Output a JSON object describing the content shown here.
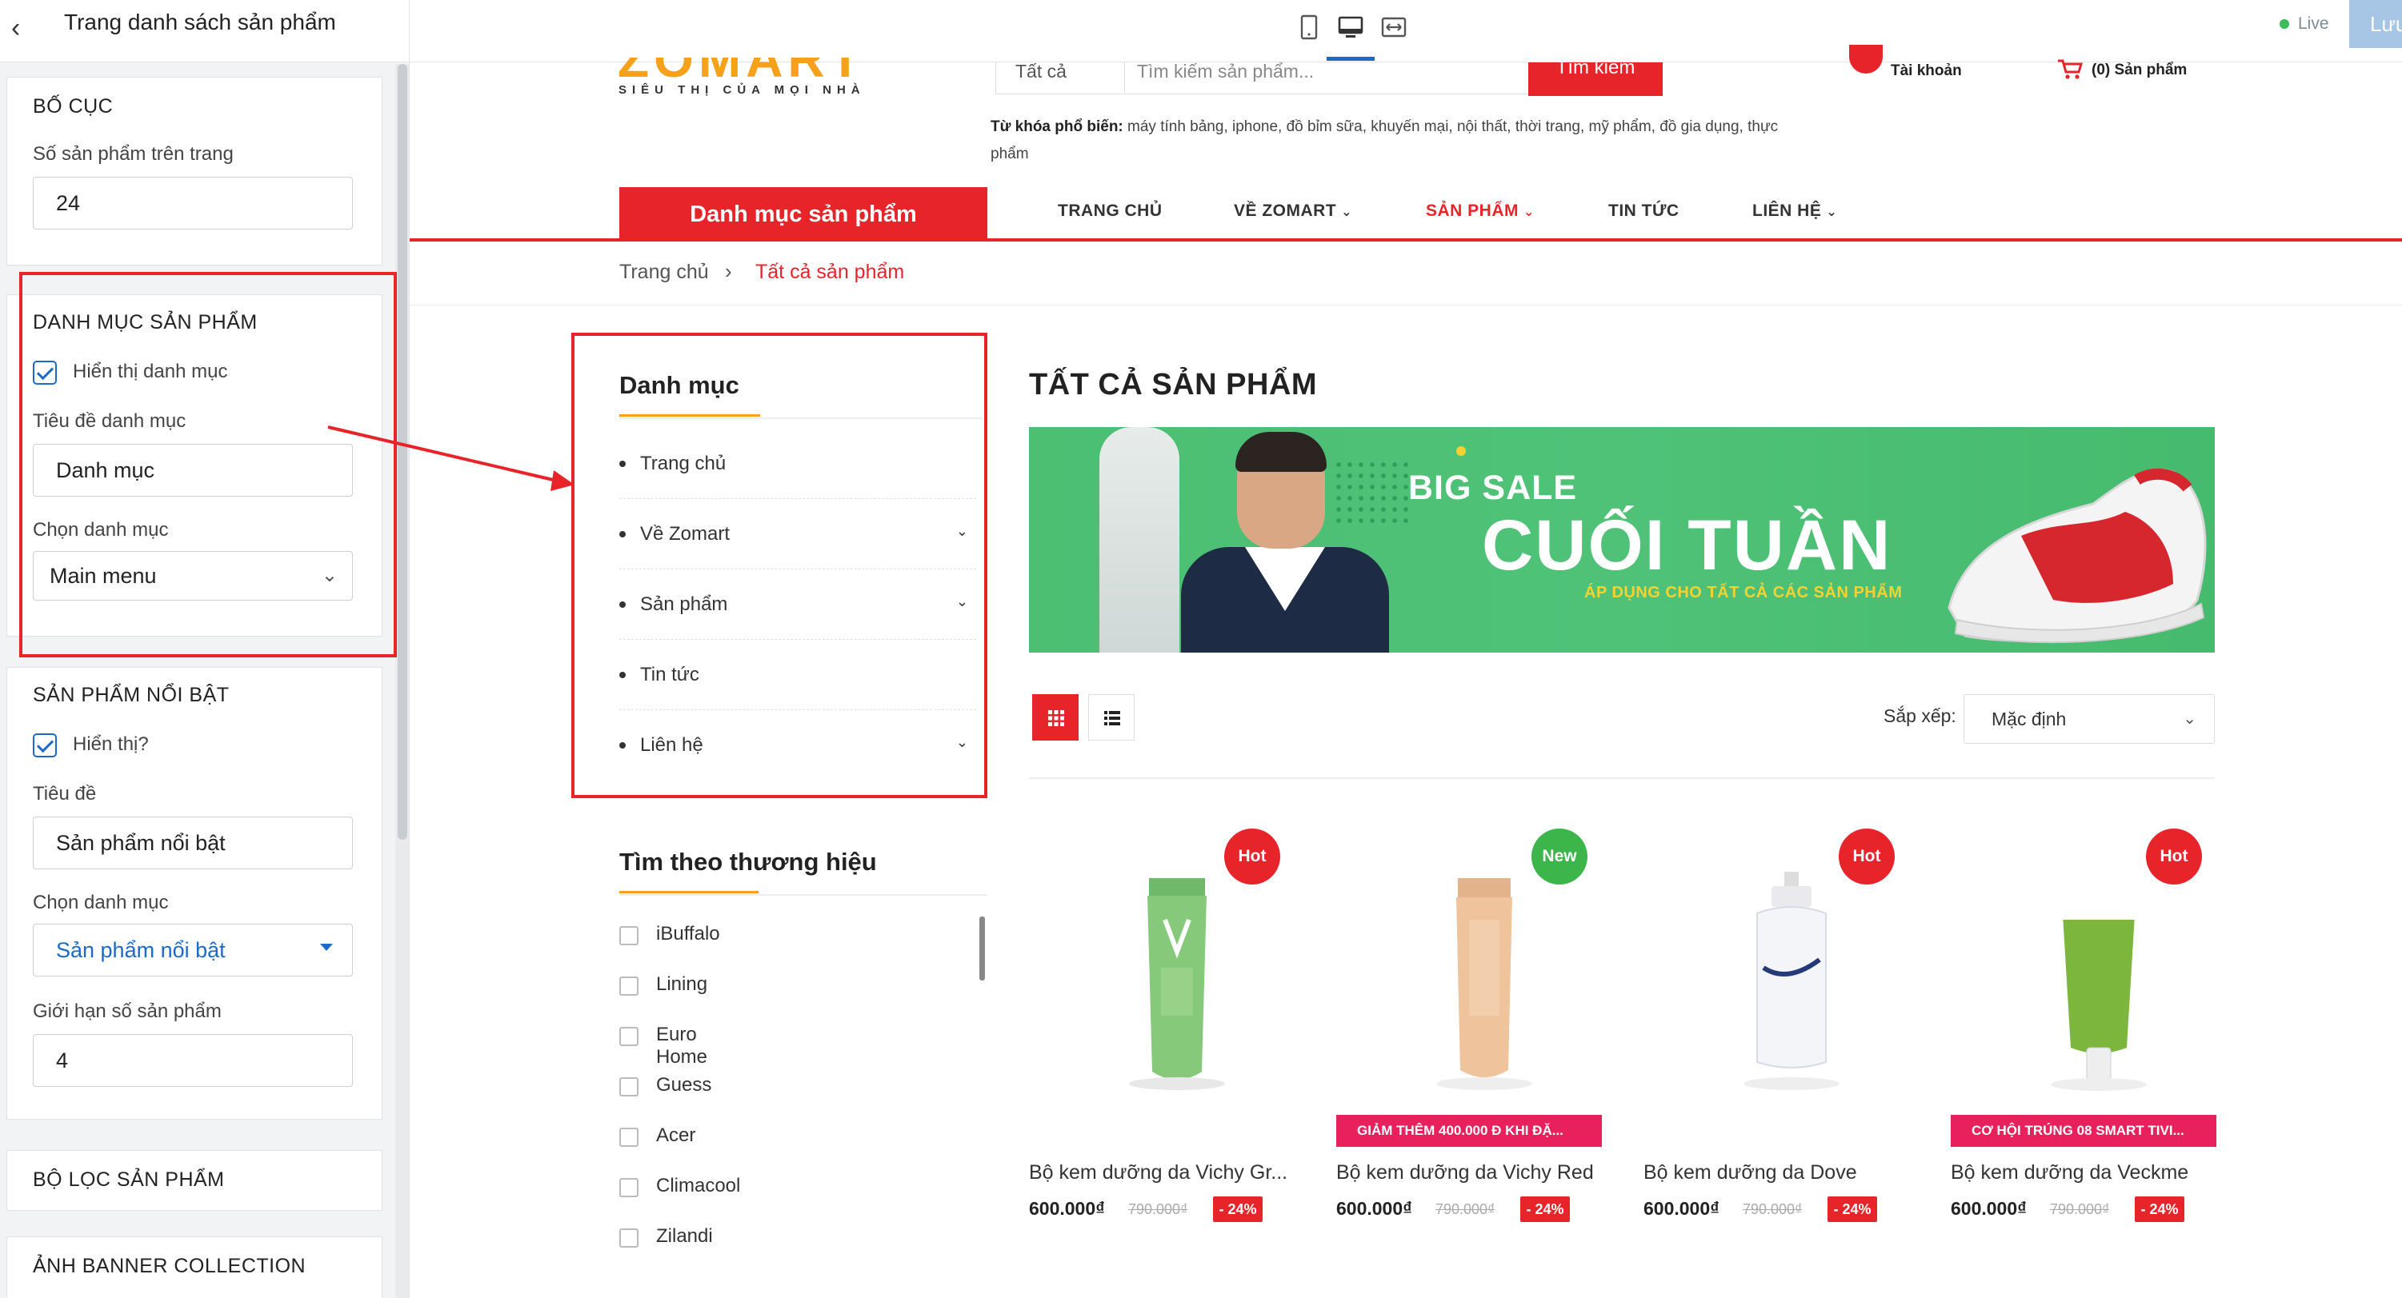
{
  "editor": {
    "title": "Trang danh sách sản phẩm",
    "layout": {
      "title": "BỐ CỤC",
      "per_page_label": "Số sản phẩm trên trang",
      "per_page_value": "24"
    },
    "category": {
      "title": "DANH MỤC SẢN PHẨM",
      "show_label": "Hiển thị danh mục",
      "title_label": "Tiêu đề danh mục",
      "title_value": "Danh mục",
      "choose_label": "Chọn danh mục",
      "choose_value": "Main menu"
    },
    "featured": {
      "title": "SẢN PHẨM NỔI BẬT",
      "show_label": "Hiển thị?",
      "title_label": "Tiêu đề",
      "title_value": "Sản phẩm nổi bật",
      "choose_label": "Chọn danh mục",
      "choose_value": "Sản phẩm nổi bật",
      "limit_label": "Giới hạn số sản phẩm",
      "limit_value": "4"
    },
    "filter": {
      "title": "BỘ LỌC SẢN PHẨM"
    },
    "banner": {
      "title": "ẢNH BANNER COLLECTION"
    }
  },
  "toolbar": {
    "live_label": "Live",
    "save_label": "Lưu"
  },
  "store": {
    "logo_tagline": "SIÊU THỊ CỦA MỌI NHÀ",
    "logo_text": "ZOMART",
    "search": {
      "category": "Tất cả",
      "placeholder": "Tìm kiếm sản phẩm...",
      "button": "Tìm kiếm"
    },
    "account_label": "Tài khoản",
    "cart_label": "(0) Sản phẩm",
    "popular_label": "Từ khóa phổ biến:",
    "popular_keywords": "máy tính bảng, iphone, đồ bỉm sữa, khuyến mại, nội thất, thời trang, mỹ phẩm, đồ gia dụng, thực phẩm",
    "category_button": "Danh mục sản phẩm",
    "nav": [
      "TRANG CHỦ",
      "VỀ ZOMART",
      "SẢN PHẨM",
      "TIN TỨC",
      "LIÊN HỆ"
    ],
    "breadcrumb": {
      "home": "Trang chủ",
      "current": "Tất cả sản phẩm"
    },
    "sidebar": {
      "menu_title": "Danh mục",
      "menu_items": [
        "Trang chủ",
        "Về Zomart",
        "Sản phẩm",
        "Tin tức",
        "Liên hệ"
      ],
      "brand_title": "Tìm theo thương hiệu",
      "brands": [
        "iBuffalo",
        "Lining",
        "Euro Home",
        "Guess",
        "Acer",
        "Climacool",
        "Zilandi"
      ]
    },
    "main_title": "TẤT CẢ SẢN PHẨM",
    "banner": {
      "big_sale": "BIG SALE",
      "headline": "CUỐI TUẦN",
      "sub": "ÁP DỤNG CHO TẤT CẢ CÁC SẢN PHẨM"
    },
    "sort_label": "Sắp xếp:",
    "sort_value": "Mặc định",
    "products": [
      {
        "badge": "Hot",
        "name": "Bộ kem dưỡng da Vichy Gr...",
        "price": "600.000₫",
        "old_price": "790.000₫",
        "discount": "- 24%",
        "promo": ""
      },
      {
        "badge": "New",
        "name": "Bộ kem dưỡng da Vichy Red",
        "price": "600.000₫",
        "old_price": "790.000₫",
        "discount": "- 24%",
        "promo": "GIẢM THÊM 400.000 Đ KHI ĐẶ..."
      },
      {
        "badge": "Hot",
        "name": "Bộ kem dưỡng da Dove",
        "price": "600.000₫",
        "old_price": "790.000₫",
        "discount": "- 24%",
        "promo": ""
      },
      {
        "badge": "Hot",
        "name": "Bộ kem dưỡng da Veckme",
        "price": "600.000₫",
        "old_price": "790.000₫",
        "discount": "- 24%",
        "promo": "CƠ HỘI TRÚNG 08 SMART TIVI..."
      }
    ]
  },
  "colors": {
    "accent": "#e8242b",
    "editor_blue": "#1b6ac9",
    "logo_orange": "#f7a11a",
    "banner_green": "#4cbf73"
  }
}
